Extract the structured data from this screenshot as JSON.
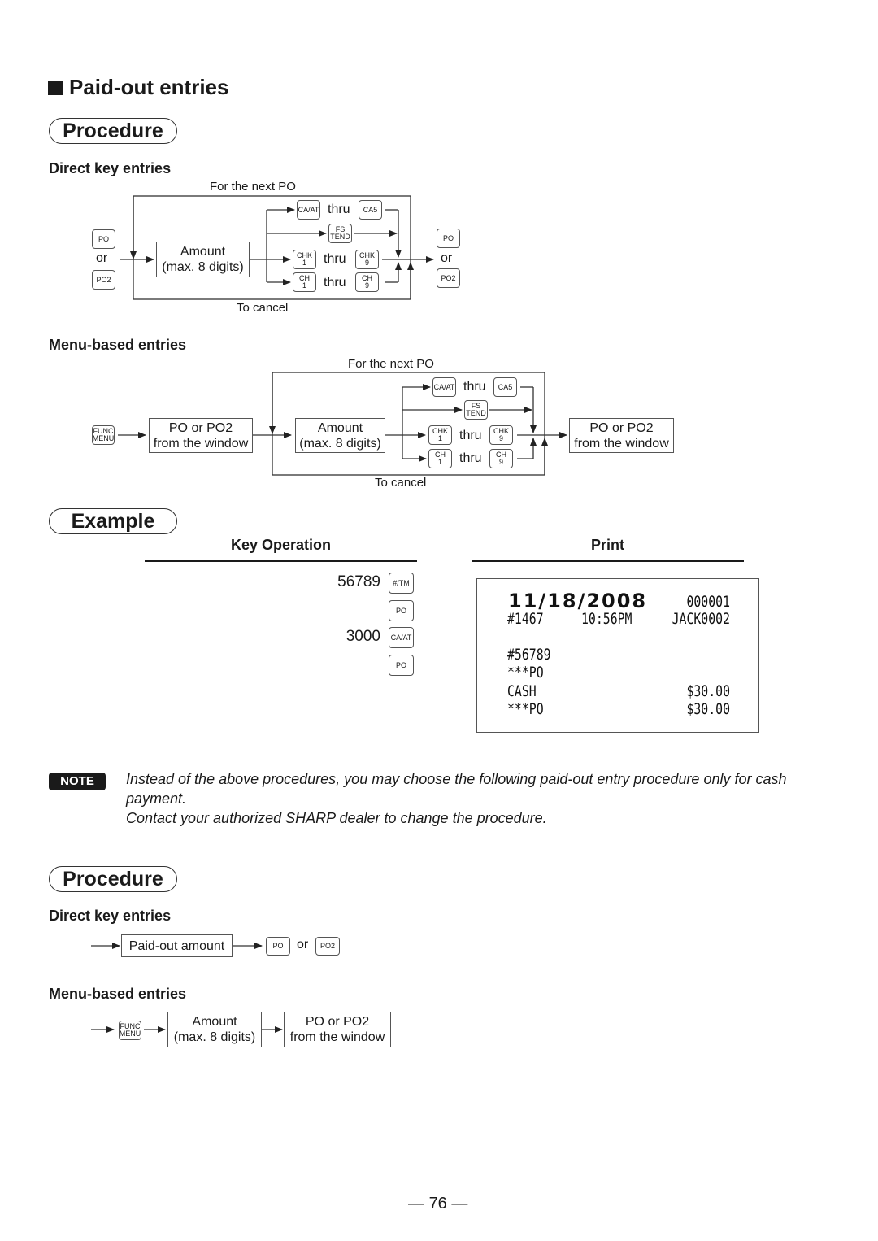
{
  "section": {
    "title": "Paid-out entries"
  },
  "procedure1": {
    "pill_label": "Procedure",
    "direct": {
      "heading": "Direct key entries",
      "loop_top_label": "For the next PO",
      "loop_bottom_label": "To cancel",
      "start_keys": [
        "PO",
        "PO2"
      ],
      "or_label": "or",
      "amount_box": [
        "Amount",
        "(max. 8 digits)"
      ],
      "thru_label": "thru",
      "tender_rows": [
        {
          "from": [
            "CA/AT"
          ],
          "to": [
            "CA5"
          ]
        },
        {
          "single": [
            "FS",
            "TEND"
          ]
        },
        {
          "from": [
            "CHK",
            "1"
          ],
          "to": [
            "CHK",
            "9"
          ]
        },
        {
          "from": [
            "CH",
            "1"
          ],
          "to": [
            "CH",
            "9"
          ]
        }
      ],
      "end_keys": [
        "PO",
        "PO2"
      ]
    },
    "menu": {
      "heading": "Menu-based entries",
      "loop_top_label": "For the next PO",
      "loop_bottom_label": "To cancel",
      "func_key": [
        "FUNC",
        "MENU"
      ],
      "window_box": [
        "PO or PO2",
        "from the window"
      ],
      "amount_box": [
        "Amount",
        "(max. 8 digits)"
      ],
      "thru_label": "thru",
      "end_box": [
        "PO or PO2",
        "from the window"
      ]
    }
  },
  "example": {
    "pill_label": "Example",
    "key_operation_header": "Key Operation",
    "print_header": "Print",
    "key_ops": [
      {
        "number": "56789",
        "key": "#/TM"
      },
      {
        "number": "",
        "key": "PO"
      },
      {
        "number": "3000",
        "key": "CA/AT"
      },
      {
        "number": "",
        "key": "PO"
      }
    ],
    "receipt": {
      "date": "11/18/2008",
      "consecutive_no": "000001",
      "machine_no": "#1467",
      "time": "10:56PM",
      "clerk": "JACK0002",
      "lines": [
        {
          "left": "#56789",
          "right": ""
        },
        {
          "left": "***PO",
          "right": ""
        },
        {
          "left": "CASH",
          "right": "$30.00"
        },
        {
          "left": "***PO",
          "right": "$30.00"
        }
      ]
    }
  },
  "note": {
    "badge": "NOTE",
    "line1": "Instead of the above procedures, you may choose the following paid-out entry procedure only for cash",
    "line2": "payment.",
    "line3": "Contact your authorized SHARP dealer to change the procedure."
  },
  "procedure2": {
    "pill_label": "Procedure",
    "direct": {
      "heading": "Direct key entries",
      "amount_box": "Paid-out amount",
      "keys": [
        "PO",
        "PO2"
      ],
      "or_label": "or"
    },
    "menu": {
      "heading": "Menu-based entries",
      "func_key": [
        "FUNC",
        "MENU"
      ],
      "amount_box": [
        "Amount",
        "(max. 8 digits)"
      ],
      "end_box": [
        "PO or PO2",
        "from the window"
      ]
    }
  },
  "page_number": "76"
}
